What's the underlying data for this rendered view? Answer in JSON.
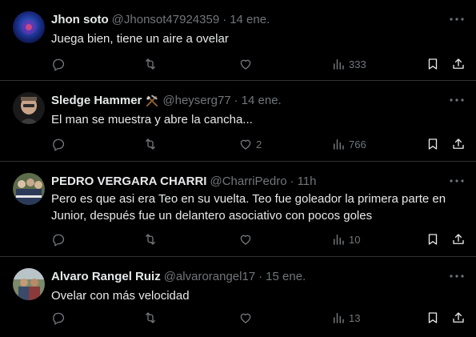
{
  "colors": {
    "background": "#000000",
    "text": "#e7e9ea",
    "muted": "#71767b",
    "divider": "#2f3336"
  },
  "icons": {
    "reply": "reply-icon",
    "retweet": "retweet-icon",
    "like": "heart-icon",
    "views": "views-icon",
    "bookmark": "bookmark-icon",
    "share": "share-icon",
    "more": "more-icon"
  },
  "tweets": [
    {
      "name": "Jhon soto",
      "emoji": "",
      "handle": "@Jhonsot47924359",
      "dot": "·",
      "time": "14 ene.",
      "text": "Juega bien, tiene un aire a ovelar",
      "replies": "",
      "retweets": "",
      "likes": "",
      "views": "333"
    },
    {
      "name": "Sledge Hammer",
      "emoji": "hammer-and-pick-emoji",
      "handle": "@heyserg77",
      "dot": "·",
      "time": "14 ene.",
      "text": "El man se muestra y abre la cancha...",
      "replies": "",
      "retweets": "",
      "likes": "2",
      "views": "766"
    },
    {
      "name": "PEDRO VERGARA CHARRI",
      "emoji": "",
      "handle": "@CharriPedro",
      "dot": "·",
      "time": "11h",
      "text": "Pero es que asi era Teo en su vuelta. Teo fue goleador la primera parte en Junior, después fue un delantero asociativo con pocos goles",
      "replies": "",
      "retweets": "",
      "likes": "",
      "views": "10"
    },
    {
      "name": "Alvaro Rangel Ruiz",
      "emoji": "",
      "handle": "@alvarorangel17",
      "dot": "·",
      "time": "15 ene.",
      "text": "Ovelar con más velocidad",
      "replies": "",
      "retweets": "",
      "likes": "",
      "views": "13"
    }
  ]
}
